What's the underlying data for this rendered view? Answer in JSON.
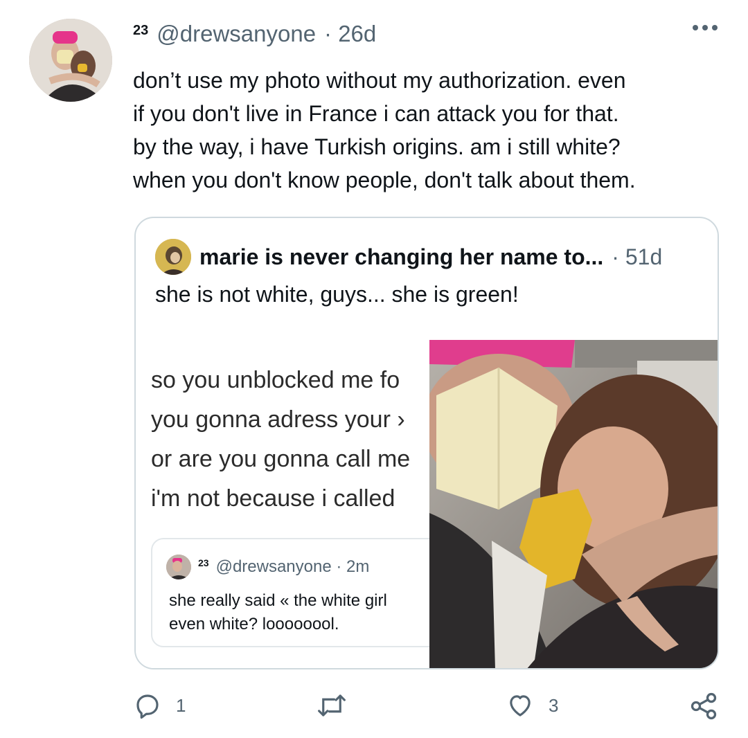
{
  "tweet": {
    "badge": "23",
    "handle": "@drewsanyone",
    "time": "· 26d",
    "lines": [
      "don’t use my photo without my authorization. even",
      "if you don't live in France i can attack you for that.",
      "by the way, i have Turkish origins. am i still white?",
      "when you don't know people, don't talk about them."
    ]
  },
  "quote": {
    "name": "marie is never changing her name to...",
    "time": "· 51d",
    "text": "she is not white, guys... she is green!",
    "screenshot": {
      "lines": [
        "so you unblocked me fo",
        "you gonna adress your ›",
        "or are you gonna call me",
        "i'm not because i called"
      ],
      "inner_tweet": {
        "badge": "23",
        "handle": "@drewsanyone · 2m",
        "lines": [
          "she really said « the white girl",
          "even white? loooooool."
        ]
      }
    }
  },
  "actions": {
    "reply_count": "1",
    "retweet_count": "",
    "like_count": "3"
  },
  "icons": {
    "more": "more-dots-icon",
    "reply": "reply-icon",
    "retweet": "retweet-icon",
    "like": "heart-icon",
    "share": "share-icon"
  },
  "colors": {
    "text": "#0f1419",
    "secondary": "#536471",
    "border": "#cfd9de"
  }
}
